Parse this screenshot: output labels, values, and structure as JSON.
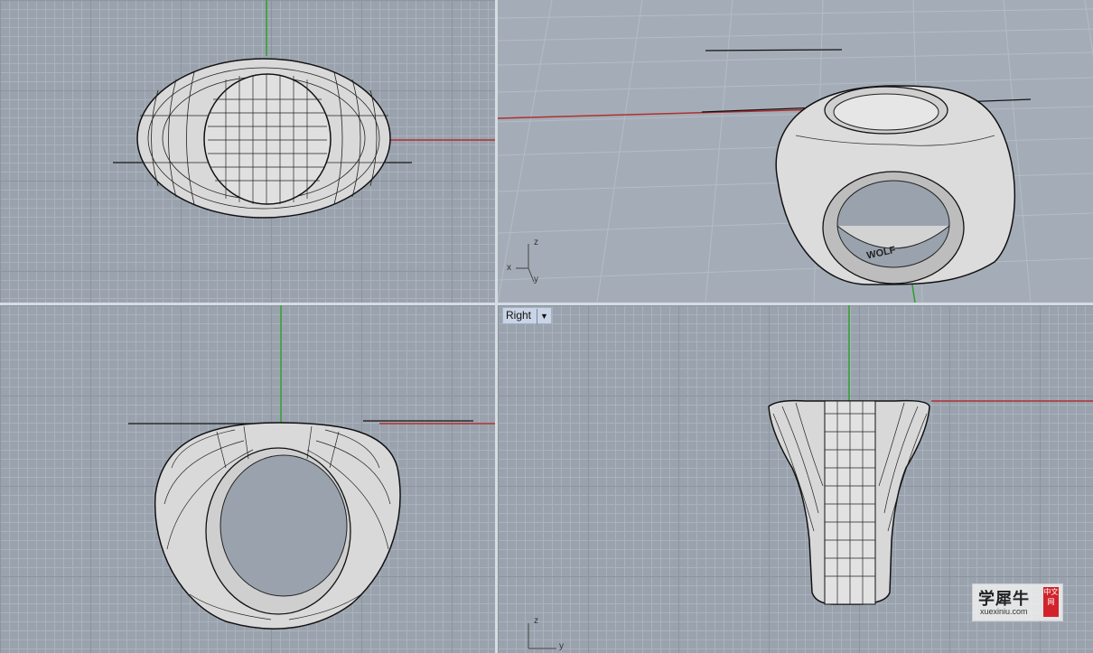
{
  "viewports": {
    "right": {
      "title": "Right"
    }
  },
  "axis_labels": {
    "persp_z": "z",
    "persp_x": "x",
    "persp_y": "y",
    "right_z": "z",
    "right_y": "y"
  },
  "perspective_engraving": "WOLF",
  "watermark": {
    "brand": "学犀牛",
    "url": "xuexiniu.com",
    "seal": "中文网"
  },
  "colors": {
    "grid_bg": "#9aa3ad",
    "x_axis": "#b03030",
    "y_axis": "#2e9e2e",
    "surface": "#d8d8d8"
  }
}
